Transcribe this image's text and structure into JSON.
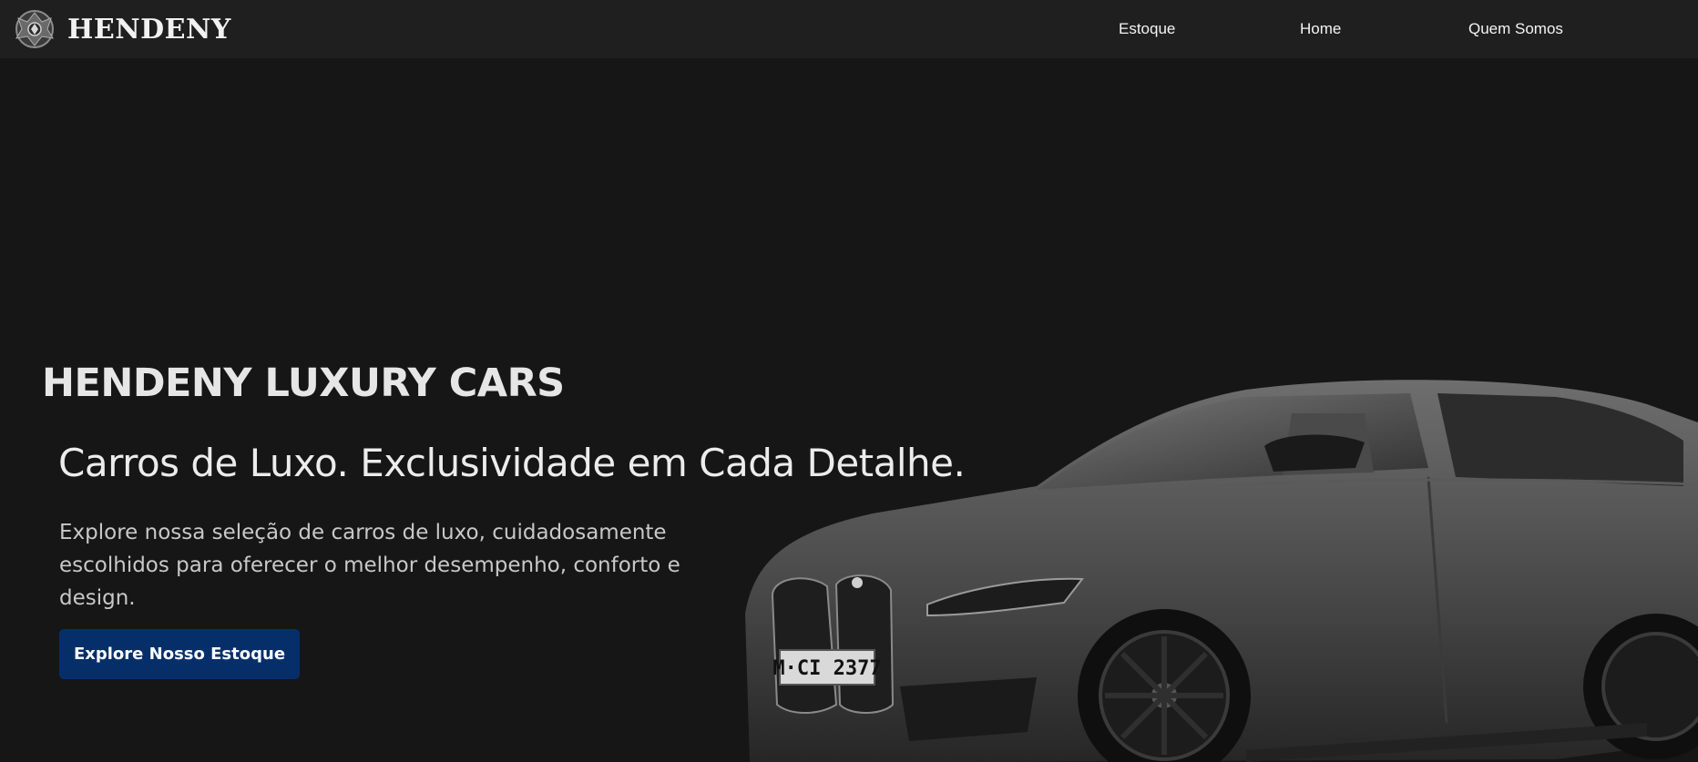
{
  "header": {
    "brand_name": "HENDENY",
    "logo_icon": "crest-emblem-icon",
    "nav": [
      {
        "label": "Estoque"
      },
      {
        "label": "Home"
      },
      {
        "label": "Quem Somos"
      }
    ]
  },
  "hero": {
    "title": "HENDENY LUXURY CARS",
    "subtitle": "Carros de Luxo. Exclusividade em Cada Detalhe.",
    "description": "Explore nossa seleção de carros de luxo, cuidadosamente escolhidos para oferecer o melhor desempenho, conforto e design.",
    "cta_label": "Explore Nosso Estoque",
    "car_plate": "M·CI 2377"
  },
  "colors": {
    "background": "#161616",
    "navbar": "#1f1f1f",
    "cta": "#062f6a",
    "text": "#e8e8e8"
  }
}
